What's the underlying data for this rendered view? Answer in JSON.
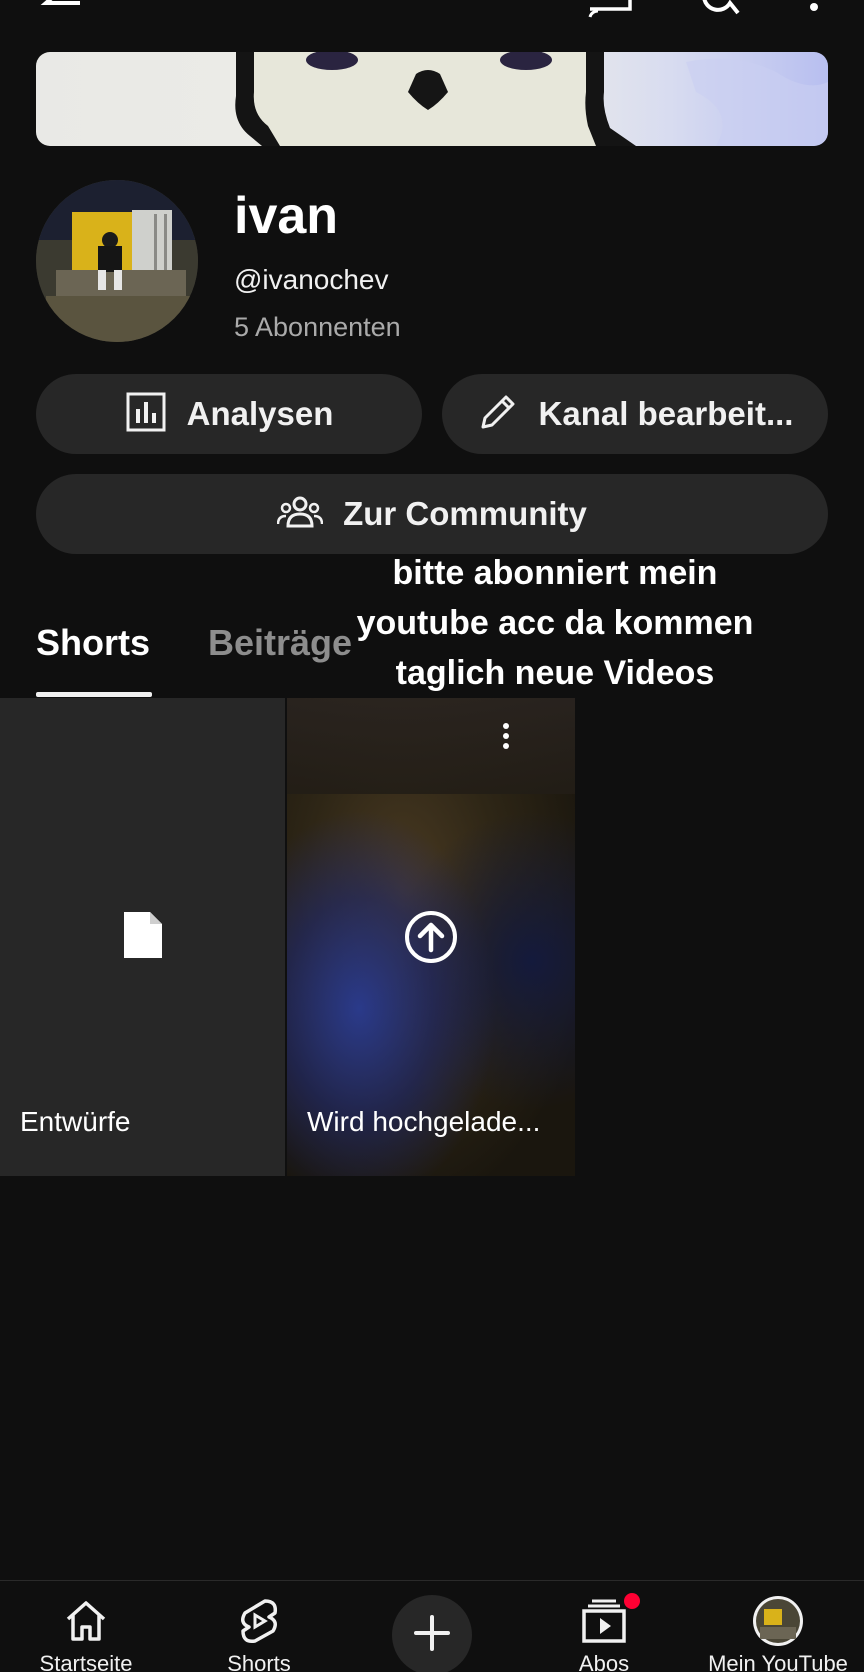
{
  "topbar": {
    "back_icon": "arrow-left-icon",
    "cast_icon": "cast-icon",
    "search_icon": "search-icon",
    "more_icon": "more-vert-icon"
  },
  "channel": {
    "name": "ivan",
    "handle": "@ivanochev",
    "subscribers": "5 Abonnenten"
  },
  "actions": {
    "analytics_label": "Analysen",
    "edit_label": "Kanal bearbeit...",
    "community_label": "Zur Community"
  },
  "overlay": {
    "line1": "bitte abonniert mein",
    "line2": "youtube acc da kommen",
    "line3": "taglich neue Videos"
  },
  "tabs": [
    {
      "label": "Shorts",
      "selected": true
    },
    {
      "label": "Beiträge",
      "selected": false
    }
  ],
  "shorts": [
    {
      "caption": "Entwürfe",
      "icon": "draft-file-icon"
    },
    {
      "caption": "Wird hochgelade...",
      "icon": "upload-icon"
    }
  ],
  "nav": [
    {
      "label": "Startseite",
      "icon": "home-icon"
    },
    {
      "label": "Shorts",
      "icon": "shorts-icon"
    },
    {
      "label": "",
      "icon": "create-plus-icon"
    },
    {
      "label": "Abos",
      "icon": "subscriptions-icon"
    },
    {
      "label": "Mein YouTube",
      "icon": "profile-avatar"
    }
  ],
  "colors": {
    "background": "#0f0f0f",
    "pill": "#272727",
    "notification": "#ff0033"
  }
}
